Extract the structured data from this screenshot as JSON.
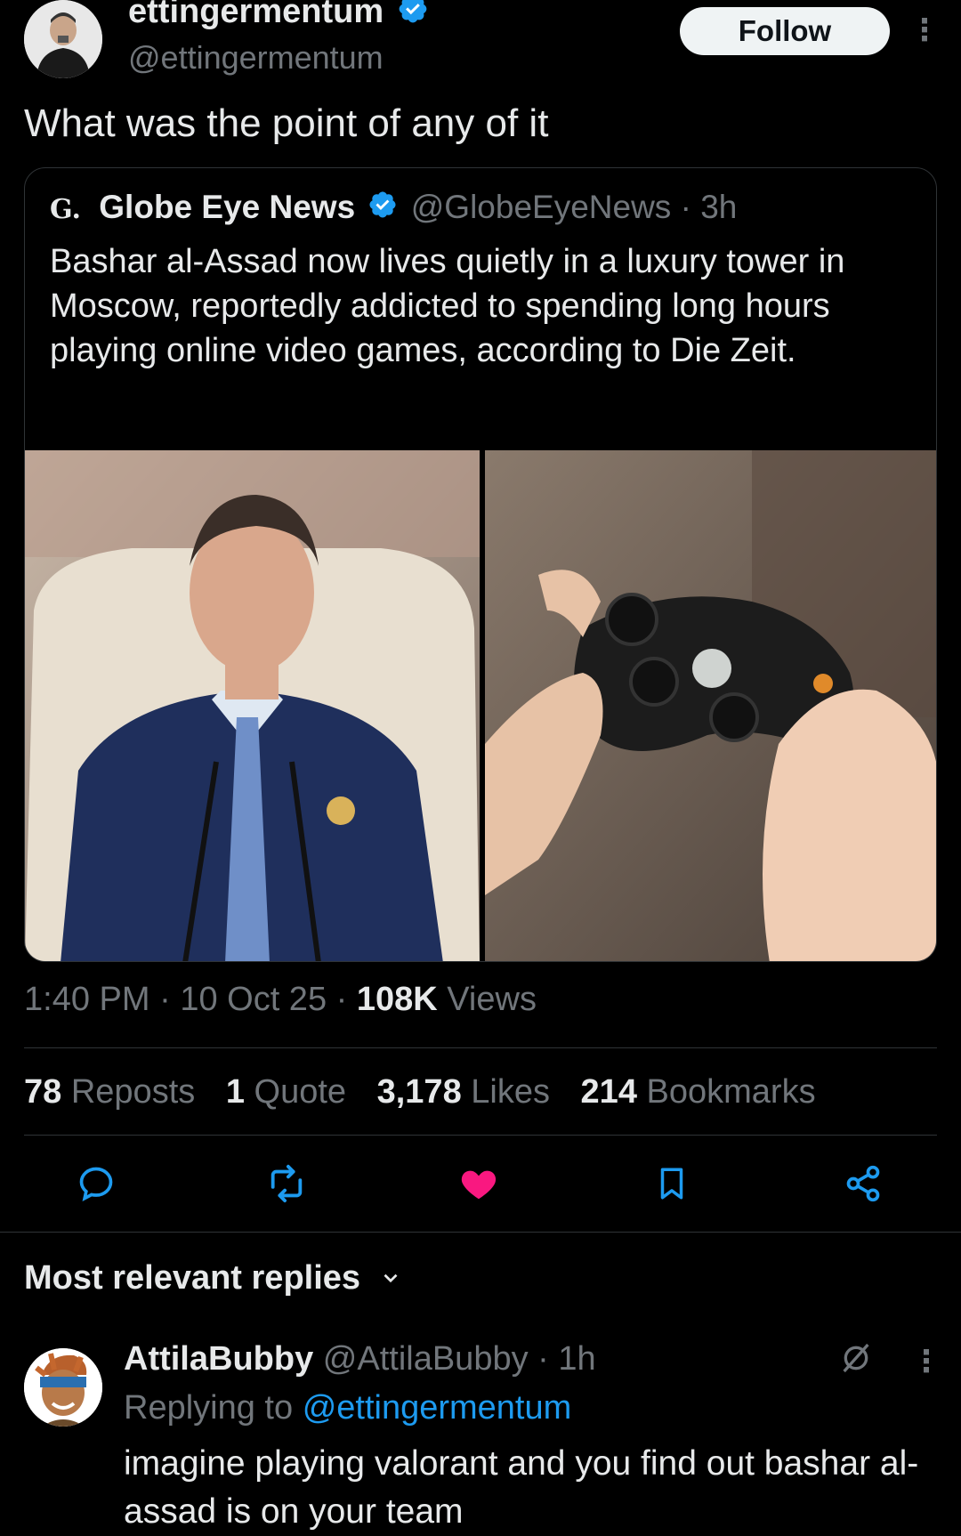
{
  "author": {
    "display_name": "ettingermentum",
    "handle": "@ettingermentum",
    "follow_label": "Follow",
    "more_label": "⋮"
  },
  "tweet": {
    "text": "What was the point of any of it"
  },
  "quoted": {
    "logo_text": "G.",
    "display_name": "Globe Eye News",
    "handle": "@GlobeEyeNews",
    "separator": "·",
    "age": "3h",
    "text": "Bashar al-Assad now lives quietly in a luxury tower in Moscow, reportedly addicted to spending long hours playing online video games, according to Die Zeit."
  },
  "meta": {
    "time": "1:40 PM",
    "dot1": "·",
    "date": "10 Oct 25",
    "dot2": "·",
    "views_count": "108K",
    "views_label": "Views"
  },
  "stats": [
    {
      "count": "78",
      "label": "Reposts"
    },
    {
      "count": "1",
      "label": "Quote"
    },
    {
      "count": "3,178",
      "label": "Likes"
    },
    {
      "count": "214",
      "label": "Bookmarks"
    }
  ],
  "actions": {
    "icons": [
      "reply-icon",
      "repost-icon",
      "like-icon",
      "bookmark-icon",
      "share-icon"
    ],
    "like_color": "#f91880"
  },
  "replies_section": {
    "title": "Most relevant replies",
    "chevron": "⌄"
  },
  "reply": {
    "display_name": "AttilaBubby",
    "handle": "@AttilaBubby",
    "separator": "·",
    "age": "1h",
    "replying_prefix": "Replying to",
    "replying_handle": "@ettingermentum",
    "text": "imagine playing valorant and you find out bashar al-assad is on your team",
    "more_label": "⋮"
  }
}
